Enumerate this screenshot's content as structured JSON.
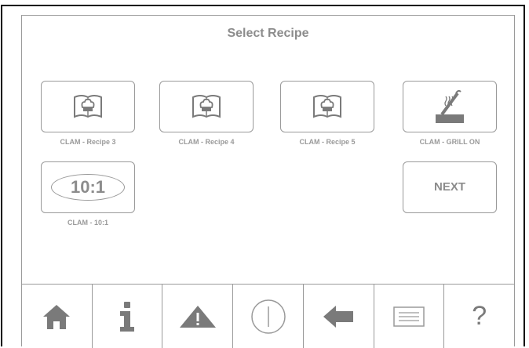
{
  "screen": {
    "title": "Select Recipe"
  },
  "recipes": [
    {
      "label": "CLAM - Recipe 3",
      "icon": "chef-book-icon"
    },
    {
      "label": "CLAM - Recipe 4",
      "icon": "chef-book-icon"
    },
    {
      "label": "CLAM - Recipe 5",
      "icon": "chef-book-icon"
    },
    {
      "label": "CLAM - GRILL ON",
      "icon": "grill-icon"
    },
    {
      "label": "CLAM - 10:1",
      "icon": "ratio-icon",
      "badge": "10:1"
    }
  ],
  "next": {
    "label": "NEXT"
  },
  "nav": {
    "home": "home-icon",
    "info": "info-icon",
    "warning": "warning-icon",
    "power": "power-icon",
    "back": "back-arrow-icon",
    "menu": "menu-list-icon",
    "help": "?"
  },
  "colors": {
    "border": "#9a9a9a",
    "text": "#8c8c8c",
    "icon": "#7a7a7a"
  }
}
